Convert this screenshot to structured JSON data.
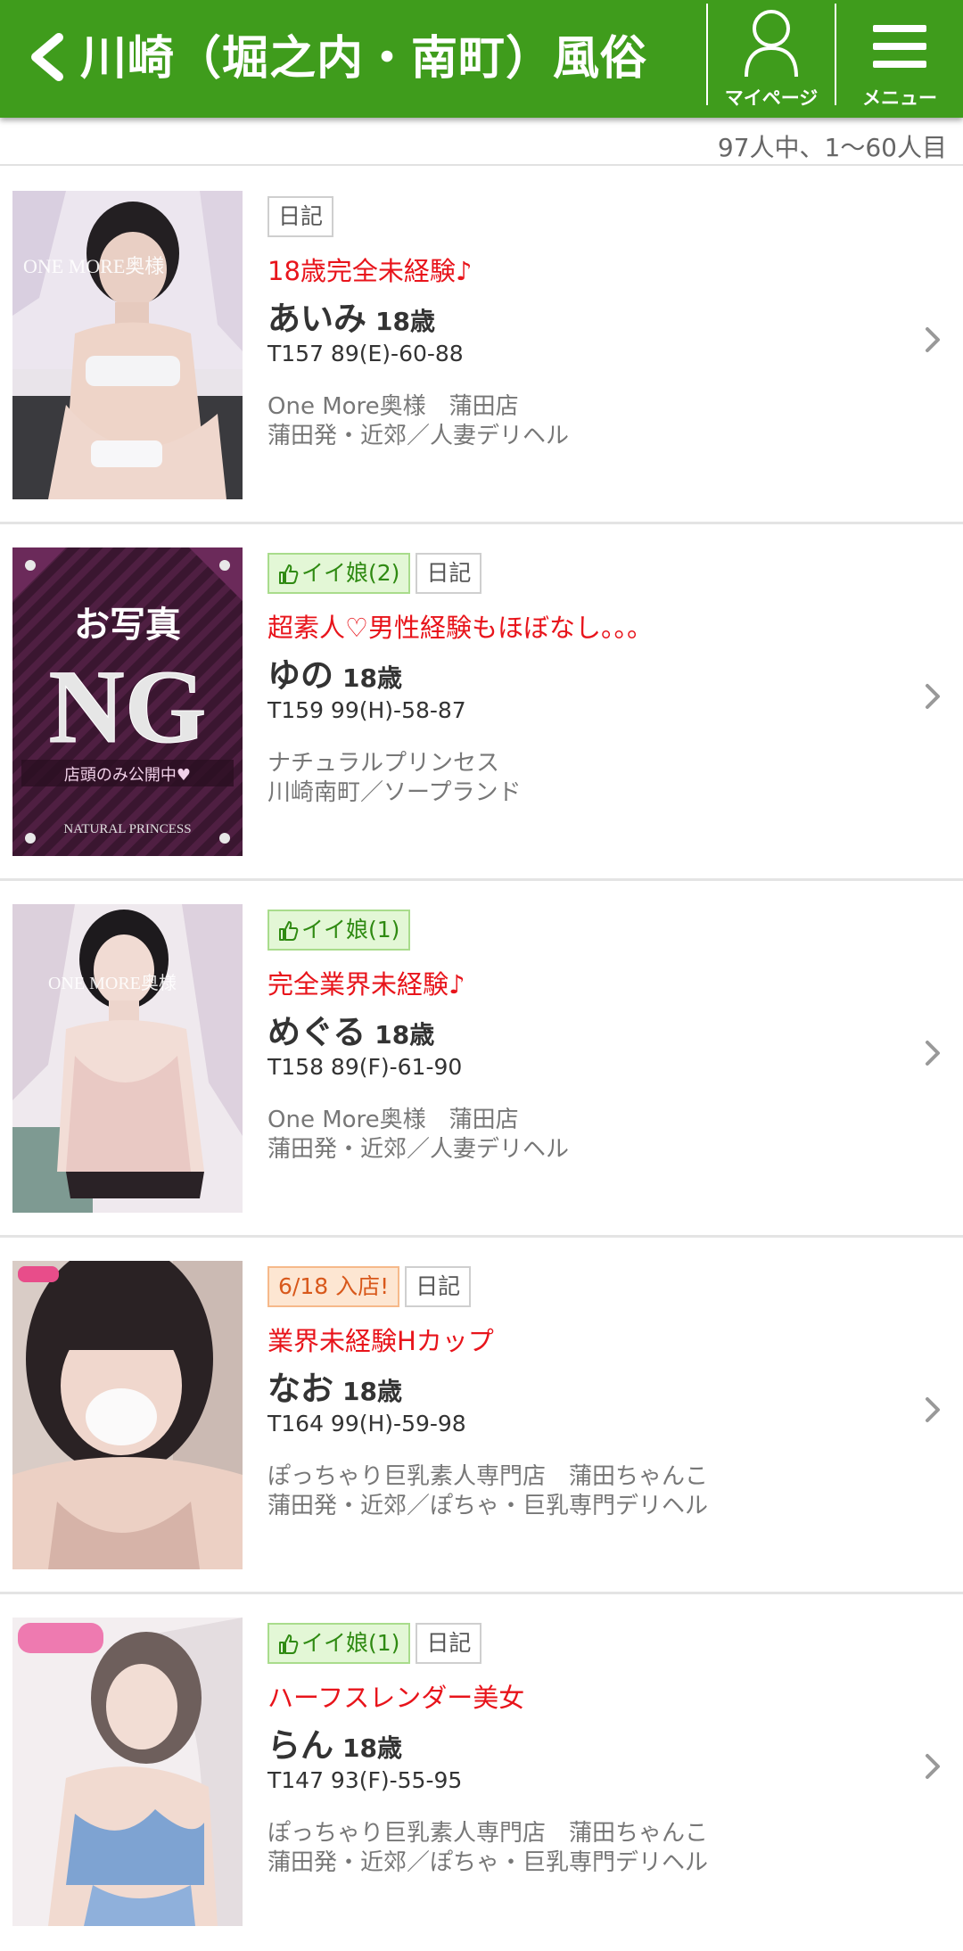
{
  "header": {
    "title": "川崎（堀之内・南町）風俗",
    "mypage_label": "マイページ",
    "menu_label": "メニュー",
    "bg_color": "#3f9c1c"
  },
  "result_count": "97人中、1〜60人目",
  "items": [
    {
      "badges": [
        "日記"
      ],
      "catch": "18歳完全未経験♪",
      "name": "あいみ",
      "age": "18歳",
      "measure": "T157 89(E)-60-88",
      "shop": "One More奥様　蒲田店",
      "area": "蒲田発・近郊／人妻デリヘル",
      "thumb_logo": "ONE MORE奥様"
    },
    {
      "badges": [
        "イイ娘(2)",
        "日記"
      ],
      "catch": "超素人♡男性経験もほぼなし。。。",
      "name": "ゆの",
      "age": "18歳",
      "measure": "T159 99(H)-58-87",
      "shop": "ナチュラルプリンセス",
      "area": "川崎南町／ソープランド",
      "thumb_top": "お写真",
      "thumb_big": "NG",
      "thumb_note": "店頭のみ公開中♥",
      "thumb_shop": "NATURAL PRINCESS"
    },
    {
      "badges": [
        "イイ娘(1)"
      ],
      "catch": "完全業界未経験♪",
      "name": "めぐる",
      "age": "18歳",
      "measure": "T158 89(F)-61-90",
      "shop": "One More奥様　蒲田店",
      "area": "蒲田発・近郊／人妻デリヘル",
      "thumb_logo": "ONE MORE奥様"
    },
    {
      "badges": [
        "6/18 入店!",
        "日記"
      ],
      "catch": "業界未経験Hカップ",
      "name": "なお",
      "age": "18歳",
      "measure": "T164 99(H)-59-98",
      "shop": "ぽっちゃり巨乳素人専門店　蒲田ちゃんこ",
      "area": "蒲田発・近郊／ぽちゃ・巨乳専門デリヘル"
    },
    {
      "badges": [
        "イイ娘(1)",
        "日記"
      ],
      "catch": "ハーフスレンダー美女",
      "name": "らん",
      "age": "18歳",
      "measure": "T147 93(F)-55-95",
      "shop": "ぽっちゃり巨乳素人専門店　蒲田ちゃんこ",
      "area": "蒲田発・近郊／ぽちゃ・巨乳専門デリヘル"
    }
  ]
}
